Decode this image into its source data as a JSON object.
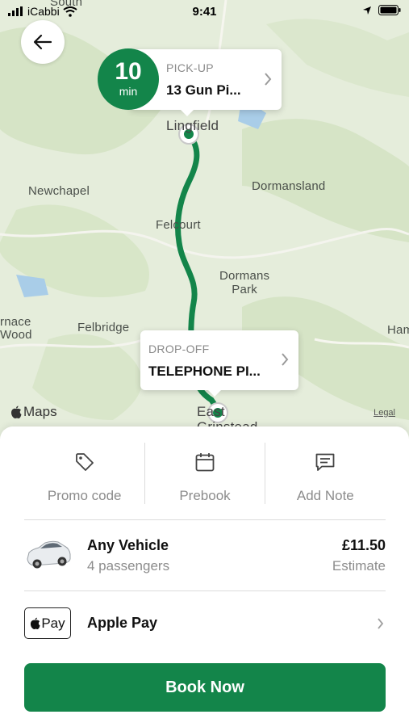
{
  "status_bar": {
    "carrier": "iCabbi",
    "time": "9:41"
  },
  "map": {
    "places": {
      "south": "South",
      "lingfield": "Lingfield",
      "newchapel": "Newchapel",
      "dormansland": "Dormansland",
      "felcourt": "Felcourt",
      "dormans_park": "Dormans\nPark",
      "furnace_wood": "rnace\nWood",
      "felbridge": "Felbridge",
      "ham": "Ham",
      "east_grinstead": "East\nGrinstead"
    },
    "maps_label": "Maps",
    "legal_label": "Legal",
    "route_color": "#13854a"
  },
  "eta": {
    "value": "10",
    "unit": "min"
  },
  "pickup": {
    "label": "PICK-UP",
    "address": "13 Gun Pi..."
  },
  "dropoff": {
    "label": "DROP-OFF",
    "address": "TELEPHONE PI..."
  },
  "actions": [
    {
      "label": "Promo code",
      "icon": "tag-icon"
    },
    {
      "label": "Prebook",
      "icon": "calendar-icon"
    },
    {
      "label": "Add Note",
      "icon": "note-icon"
    }
  ],
  "vehicle": {
    "name": "Any Vehicle",
    "passengers": "4 passengers",
    "price": "£11.50",
    "price_note": "Estimate"
  },
  "payment": {
    "badge_text": "Pay",
    "method": "Apple Pay"
  },
  "book_button": "Book Now",
  "colors": {
    "accent": "#13854a"
  }
}
